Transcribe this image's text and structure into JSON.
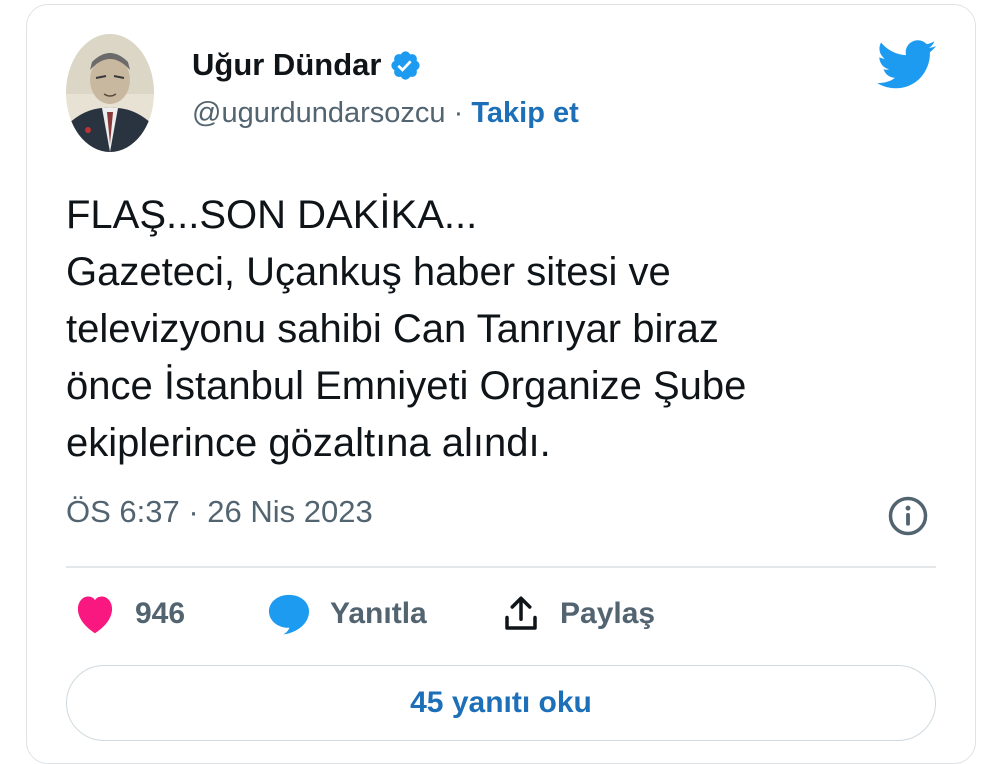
{
  "author": {
    "name": "Uğur Dündar",
    "handle": "@ugurdundarsozcu",
    "separator": "·",
    "follow_label": "Takip et",
    "verified_icon": "verified-badge-icon",
    "avatar_icon": "portrait-avatar"
  },
  "brand": {
    "icon": "twitter-bird-icon",
    "color": "#1d9bf0"
  },
  "tweet": {
    "lines": [
      "FLAŞ...SON DAKİKA...",
      "Gazeteci, Uçankuş haber sitesi ve",
      "televizyonu sahibi Can Tanrıyar biraz",
      "önce İstanbul Emniyeti Organize Şube",
      "ekiplerince gözaltına alındı."
    ],
    "timestamp": "ÖS 6:37 · 26 Nis 2023",
    "info_icon": "info-icon"
  },
  "actions": {
    "like": {
      "icon": "heart-icon",
      "count": "946",
      "color": "#f91880"
    },
    "reply": {
      "icon": "speech-bubble-icon",
      "label": "Yanıtla",
      "color": "#1d9bf0"
    },
    "share": {
      "icon": "share-icon",
      "label": "Paylaş"
    }
  },
  "read_replies": {
    "label": "45 yanıtı oku"
  },
  "colors": {
    "text": "#0f1419",
    "muted": "#536471",
    "link": "#1d6fb8",
    "border": "#dfe3e6"
  }
}
